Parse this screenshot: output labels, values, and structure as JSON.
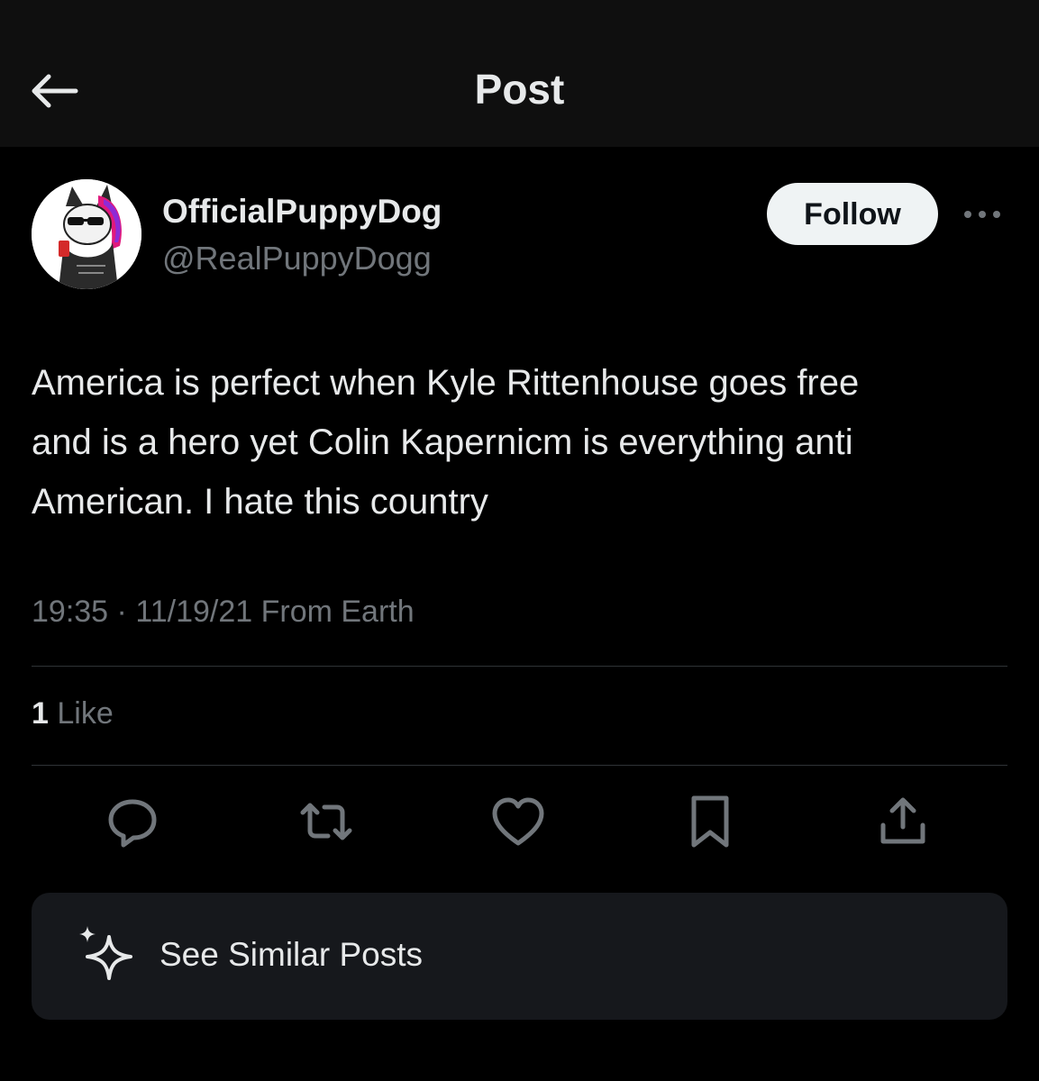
{
  "header": {
    "title": "Post",
    "back_icon": "arrow-left-icon"
  },
  "author": {
    "display_name": "OfficialPuppyDog",
    "handle": "@RealPuppyDogg"
  },
  "follow_label": "Follow",
  "more_icon": "ellipsis-icon",
  "post": {
    "text": "America is perfect when Kyle Rittenhouse goes free\nand is a hero yet Colin Kapernicm is everything anti\nAmerican. I hate this country",
    "time": "19:35",
    "separator": "·",
    "date": "11/19/21",
    "source": "From Earth"
  },
  "stats": {
    "like_count": "1",
    "like_label": "Like"
  },
  "actions": [
    {
      "icon": "reply-icon"
    },
    {
      "icon": "repost-icon"
    },
    {
      "icon": "heart-icon"
    },
    {
      "icon": "bookmark-icon"
    },
    {
      "icon": "share-icon"
    }
  ],
  "similar": {
    "label": "See Similar Posts",
    "icon": "sparkle-icon"
  },
  "colors": {
    "background": "#000000",
    "header_bg": "#0f0f0f",
    "text_primary": "#e7e9ea",
    "text_secondary": "#71767b",
    "divider": "#2f3336",
    "card_bg": "#16181c",
    "follow_bg": "#eff3f4",
    "avatar_accent": "#e0197d"
  }
}
